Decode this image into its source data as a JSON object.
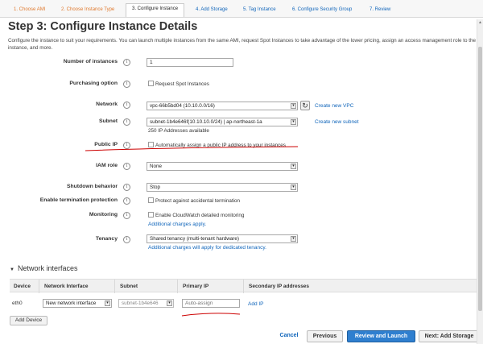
{
  "wizard": {
    "tabs": [
      {
        "label": "1. Choose AMI"
      },
      {
        "label": "2. Choose Instance Type"
      },
      {
        "label": "3. Configure Instance"
      },
      {
        "label": "4. Add Storage"
      },
      {
        "label": "5. Tag Instance"
      },
      {
        "label": "6. Configure Security Group"
      },
      {
        "label": "7. Review"
      }
    ]
  },
  "page": {
    "title": "Step 3: Configure Instance Details",
    "description": "Configure the instance to suit your requirements. You can launch multiple instances from the same AMI, request Spot Instances to take advantage of the lower pricing, assign an access management role to the instance, and more."
  },
  "form": {
    "info_glyph": "i",
    "select_arrow_glyph": "▾",
    "number_of_instances": {
      "label": "Number of instances",
      "value": "1"
    },
    "purchasing_option": {
      "label": "Purchasing option",
      "checkbox_label": "Request Spot Instances",
      "checked": false
    },
    "network": {
      "label": "Network",
      "value": "vpc-66b5bd04 (10.10.0.0/16)",
      "refresh_glyph": "↻",
      "create_link": "Create new VPC"
    },
    "subnet": {
      "label": "Subnet",
      "value": "subnet-1b4e646f(10.10.10.0/24) | ap-northeast-1a",
      "note": "250 IP Addresses available",
      "create_link": "Create new subnet"
    },
    "public_ip": {
      "label": "Public IP",
      "checkbox_label": "Automatically assign a public IP address to your instances",
      "checked": false
    },
    "iam_role": {
      "label": "IAM role",
      "value": "None"
    },
    "shutdown_behavior": {
      "label": "Shutdown behavior",
      "value": "Stop"
    },
    "termination_protection": {
      "label": "Enable termination protection",
      "checkbox_label": "Protect against accidental termination",
      "checked": false
    },
    "monitoring": {
      "label": "Monitoring",
      "checkbox_label": "Enable CloudWatch detailed monitoring",
      "link": "Additional charges apply."
    },
    "tenancy": {
      "label": "Tenancy",
      "value": "Shared tenancy (multi-tenant hardware)",
      "link": "Additional charges will apply for dedicated tenancy."
    }
  },
  "network_interfaces": {
    "heading": "Network interfaces",
    "caret_glyph": "▼",
    "columns": [
      "Device",
      "Network Interface",
      "Subnet",
      "Primary IP",
      "Secondary IP addresses"
    ],
    "rows": [
      {
        "device": "eth0",
        "network_interface": "New network interface",
        "subnet": "subnet-1b4e646",
        "primary_ip_placeholder": "Auto-assign",
        "add_ip": "Add IP"
      }
    ],
    "add_device": "Add Device"
  },
  "footer": {
    "cancel": "Cancel",
    "previous": "Previous",
    "review_and_launch": "Review and Launch",
    "next": "Next: Add Storage"
  },
  "annotations": {
    "underline_color": "#cc0000"
  },
  "colors": {
    "link": "#1166bb",
    "visited_step": "#e07a2f",
    "primary_button": "#2f7fcf"
  }
}
